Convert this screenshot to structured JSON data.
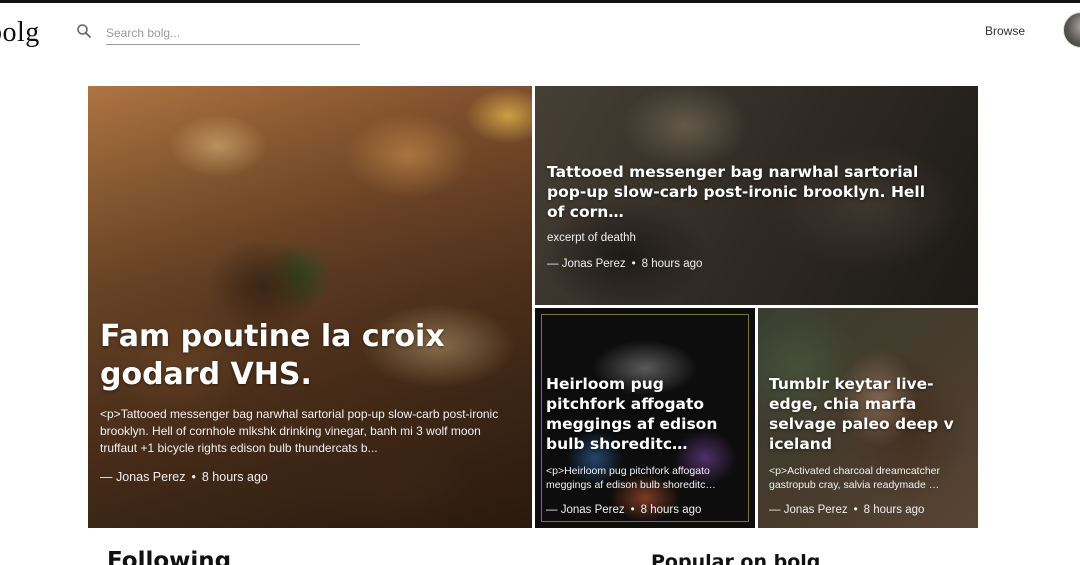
{
  "header": {
    "logo": "bolg",
    "search_placeholder": "Search bolg...",
    "browse_label": "Browse"
  },
  "icons": {
    "search": "search-icon",
    "avatar": "avatar"
  },
  "cards": [
    {
      "title": "Fam poutine la croix godard VHS.",
      "excerpt": "<p>Tattooed messenger bag narwhal sartorial pop-up slow-carb post-ironic brooklyn. Hell of cornhole mlkshk drinking vinegar, banh mi 3 wolf moon truffaut +1 bicycle rights edison bulb thundercats b...",
      "author": "— Jonas Perez",
      "time": "8 hours ago"
    },
    {
      "title": "Tattooed messenger bag narwhal sartorial pop-up slow-carb post-ironic brooklyn. Hell of corn…",
      "excerpt": "excerpt of deathh",
      "author": "— Jonas Perez",
      "time": "8 hours ago"
    },
    {
      "title": "Heirloom pug pitchfork affogato meggings af edison bulb shoreditc…",
      "excerpt": "<p>Heirloom pug pitchfork affogato meggings af edison bulb shoreditc…",
      "author": "— Jonas Perez",
      "time": "8 hours ago"
    },
    {
      "title": "Tumblr keytar live-edge, chia marfa selvage paleo deep v iceland",
      "excerpt": "<p>Activated charcoal dreamcatcher gastropub cray, salvia readymade …",
      "author": "— Jonas Perez",
      "time": "8 hours ago"
    }
  ],
  "sections": {
    "following": "Following",
    "popular": "Popular on bolg"
  },
  "meta_separator": "•"
}
